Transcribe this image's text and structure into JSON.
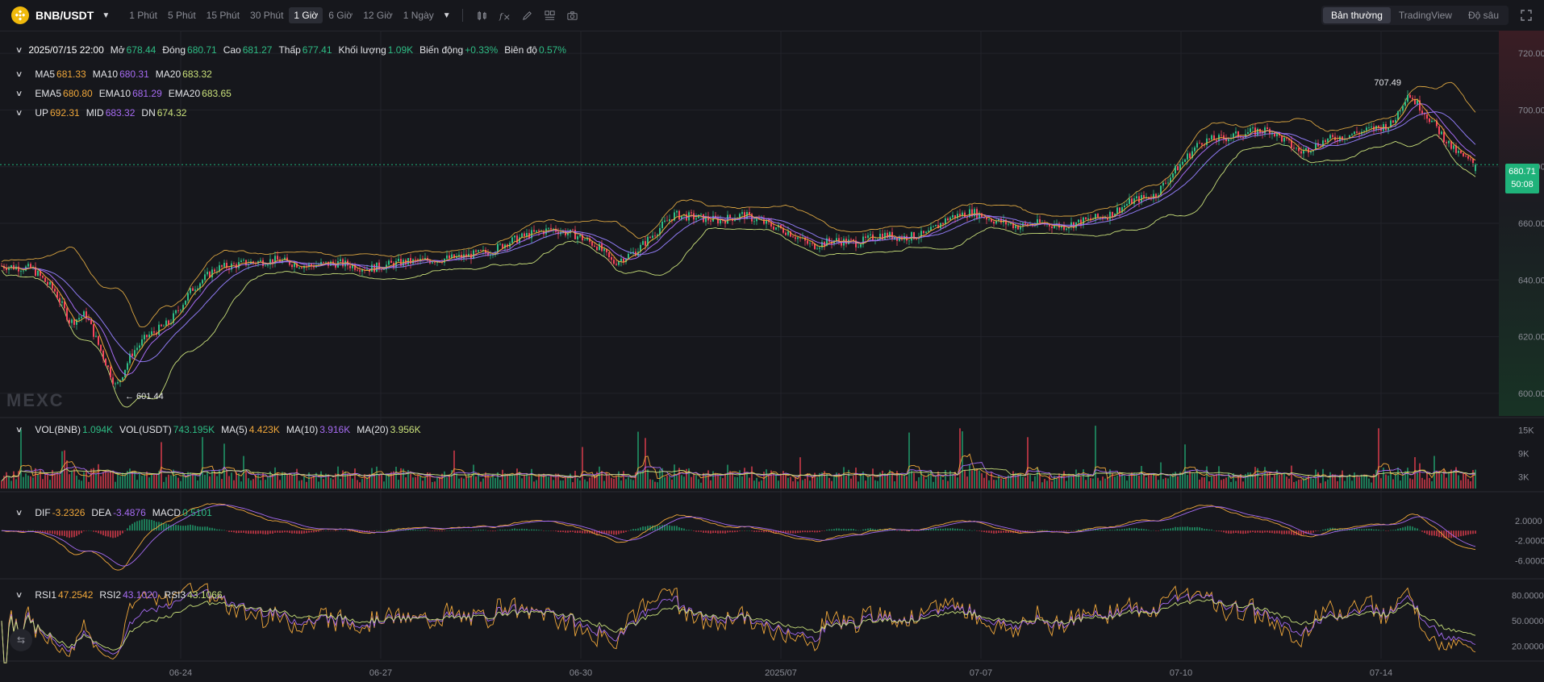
{
  "toolbar": {
    "pair": "BNB/USDT",
    "intervals": [
      "1 Phút",
      "5 Phút",
      "15 Phút",
      "30 Phút",
      "1 Giờ",
      "6 Giờ",
      "12 Giờ",
      "1 Ngày"
    ],
    "active_interval": "1 Giờ",
    "views": [
      "Bản thường",
      "TradingView",
      "Độ sâu"
    ],
    "active_view": "Bản thường",
    "tools": [
      "candle-type-icon",
      "indicator-icon",
      "draw-icon",
      "layout-icon",
      "camera-icon"
    ]
  },
  "ohlc_legend": {
    "time": "2025/07/15 22:00",
    "open_label": "Mở",
    "open": "678.44",
    "close_label": "Đóng",
    "close": "680.71",
    "high_label": "Cao",
    "high": "681.27",
    "low_label": "Thấp",
    "low": "677.41",
    "volume_label": "Khối lượng",
    "volume": "1.09K",
    "change_label": "Biến động",
    "change": "+0.33%",
    "amplitude_label": "Biên độ",
    "amplitude": "0.57%"
  },
  "ma_legend": {
    "ma5_label": "MA5",
    "ma5": "681.33",
    "ma10_label": "MA10",
    "ma10": "680.31",
    "ma20_label": "MA20",
    "ma20": "683.32"
  },
  "ema_legend": {
    "ema5_label": "EMA5",
    "ema5": "680.80",
    "ema10_label": "EMA10",
    "ema10": "681.29",
    "ema20_label": "EMA20",
    "ema20": "683.65"
  },
  "boll_legend": {
    "up_label": "UP",
    "up": "692.31",
    "mid_label": "MID",
    "mid": "683.32",
    "dn_label": "DN",
    "dn": "674.32"
  },
  "vol_legend": {
    "vol_bnb_label": "VOL(BNB)",
    "vol_bnb": "1.094K",
    "vol_usdt_label": "VOL(USDT)",
    "vol_usdt": "743.195K",
    "ma5_label": "MA(5)",
    "ma5": "4.423K",
    "ma10_label": "MA(10)",
    "ma10": "3.916K",
    "ma20_label": "MA(20)",
    "ma20": "3.956K"
  },
  "macd_legend": {
    "dif_label": "DIF",
    "dif": "-3.2326",
    "dea_label": "DEA",
    "dea": "-3.4876",
    "macd_label": "MACD",
    "macd": "0.5101"
  },
  "rsi_legend": {
    "rsi1_label": "RSI1",
    "rsi1": "47.2542",
    "rsi2_label": "RSI2",
    "rsi2": "43.1020",
    "rsi3_label": "RSI3",
    "rsi3": "43.1066"
  },
  "price_tag": {
    "price": "680.71",
    "countdown": "50:08"
  },
  "watermark": "MEXC",
  "colors": {
    "up": "#2ebd85",
    "down": "#f6465d",
    "ma5": "#f0a73a",
    "ma10": "#a66bf2",
    "ma20": "#c9e07a",
    "grid": "#22232a",
    "axis_text": "#8b8d96"
  },
  "chart_data": {
    "type": "candlestick",
    "symbol": "BNB/USDT",
    "interval": "1 Giờ",
    "price_axis": {
      "ticks": [
        600,
        620,
        640,
        660,
        680,
        700,
        720
      ],
      "tick_labels": [
        "600.00",
        "620.00",
        "640.00",
        "660.00",
        "680.00",
        "700.00",
        "720.00"
      ],
      "range": [
        592,
        728
      ]
    },
    "volume_axis": {
      "tick_labels": [
        "3K",
        "9K",
        "15K"
      ],
      "ticks": [
        3000,
        9000,
        15000
      ],
      "range": [
        0,
        18000
      ]
    },
    "macd_axis": {
      "tick_labels": [
        "-6.0000",
        "-2.0000",
        "2.0000"
      ],
      "ticks": [
        -6,
        -2,
        2
      ],
      "range": [
        -9,
        6
      ]
    },
    "rsi_axis": {
      "tick_labels": [
        "20.0000",
        "50.0000",
        "80.0000"
      ],
      "ticks": [
        20,
        50,
        80
      ],
      "range": [
        5,
        95
      ]
    },
    "x_axis": {
      "tick_labels": [
        "06-24",
        "06-27",
        "06-30",
        "2025/07",
        "07-07",
        "07-10",
        "07-14"
      ]
    },
    "markers": {
      "high_label": "707.49",
      "high_value": 707.49,
      "low_label": "601.44",
      "low_value": 601.44
    },
    "last_price": 680.71,
    "price_path": [
      [
        0,
        645
      ],
      [
        4,
        644
      ],
      [
        7,
        636
      ],
      [
        9,
        625
      ],
      [
        11,
        628
      ],
      [
        13,
        615
      ],
      [
        15,
        602
      ],
      [
        17,
        614
      ],
      [
        19,
        620
      ],
      [
        22,
        625
      ],
      [
        25,
        637
      ],
      [
        28,
        644
      ],
      [
        32,
        646
      ],
      [
        36,
        647
      ],
      [
        40,
        645
      ],
      [
        44,
        646
      ],
      [
        48,
        644
      ],
      [
        52,
        646
      ],
      [
        56,
        647
      ],
      [
        60,
        648
      ],
      [
        64,
        650
      ],
      [
        66,
        653
      ],
      [
        69,
        656
      ],
      [
        72,
        658
      ],
      [
        75,
        656
      ],
      [
        78,
        652
      ],
      [
        80,
        646
      ],
      [
        83,
        650
      ],
      [
        86,
        658
      ],
      [
        88,
        663
      ],
      [
        91,
        662
      ],
      [
        94,
        661
      ],
      [
        97,
        663
      ],
      [
        100,
        660
      ],
      [
        103,
        657
      ],
      [
        106,
        652
      ],
      [
        109,
        654
      ],
      [
        112,
        653
      ],
      [
        115,
        656
      ],
      [
        118,
        655
      ],
      [
        121,
        656
      ],
      [
        124,
        662
      ],
      [
        127,
        664
      ],
      [
        130,
        661
      ],
      [
        133,
        659
      ],
      [
        136,
        660
      ],
      [
        139,
        659
      ],
      [
        142,
        661
      ],
      [
        145,
        663
      ],
      [
        148,
        668
      ],
      [
        151,
        670
      ],
      [
        154,
        680
      ],
      [
        157,
        689
      ],
      [
        160,
        690
      ],
      [
        163,
        692
      ],
      [
        166,
        693
      ],
      [
        168,
        689
      ],
      [
        170,
        685
      ],
      [
        173,
        689
      ],
      [
        176,
        691
      ],
      [
        179,
        693
      ],
      [
        182,
        695
      ],
      [
        184,
        706
      ],
      [
        186,
        700
      ],
      [
        188,
        693
      ],
      [
        190,
        686
      ],
      [
        192,
        682
      ],
      [
        193,
        680.71
      ]
    ]
  }
}
